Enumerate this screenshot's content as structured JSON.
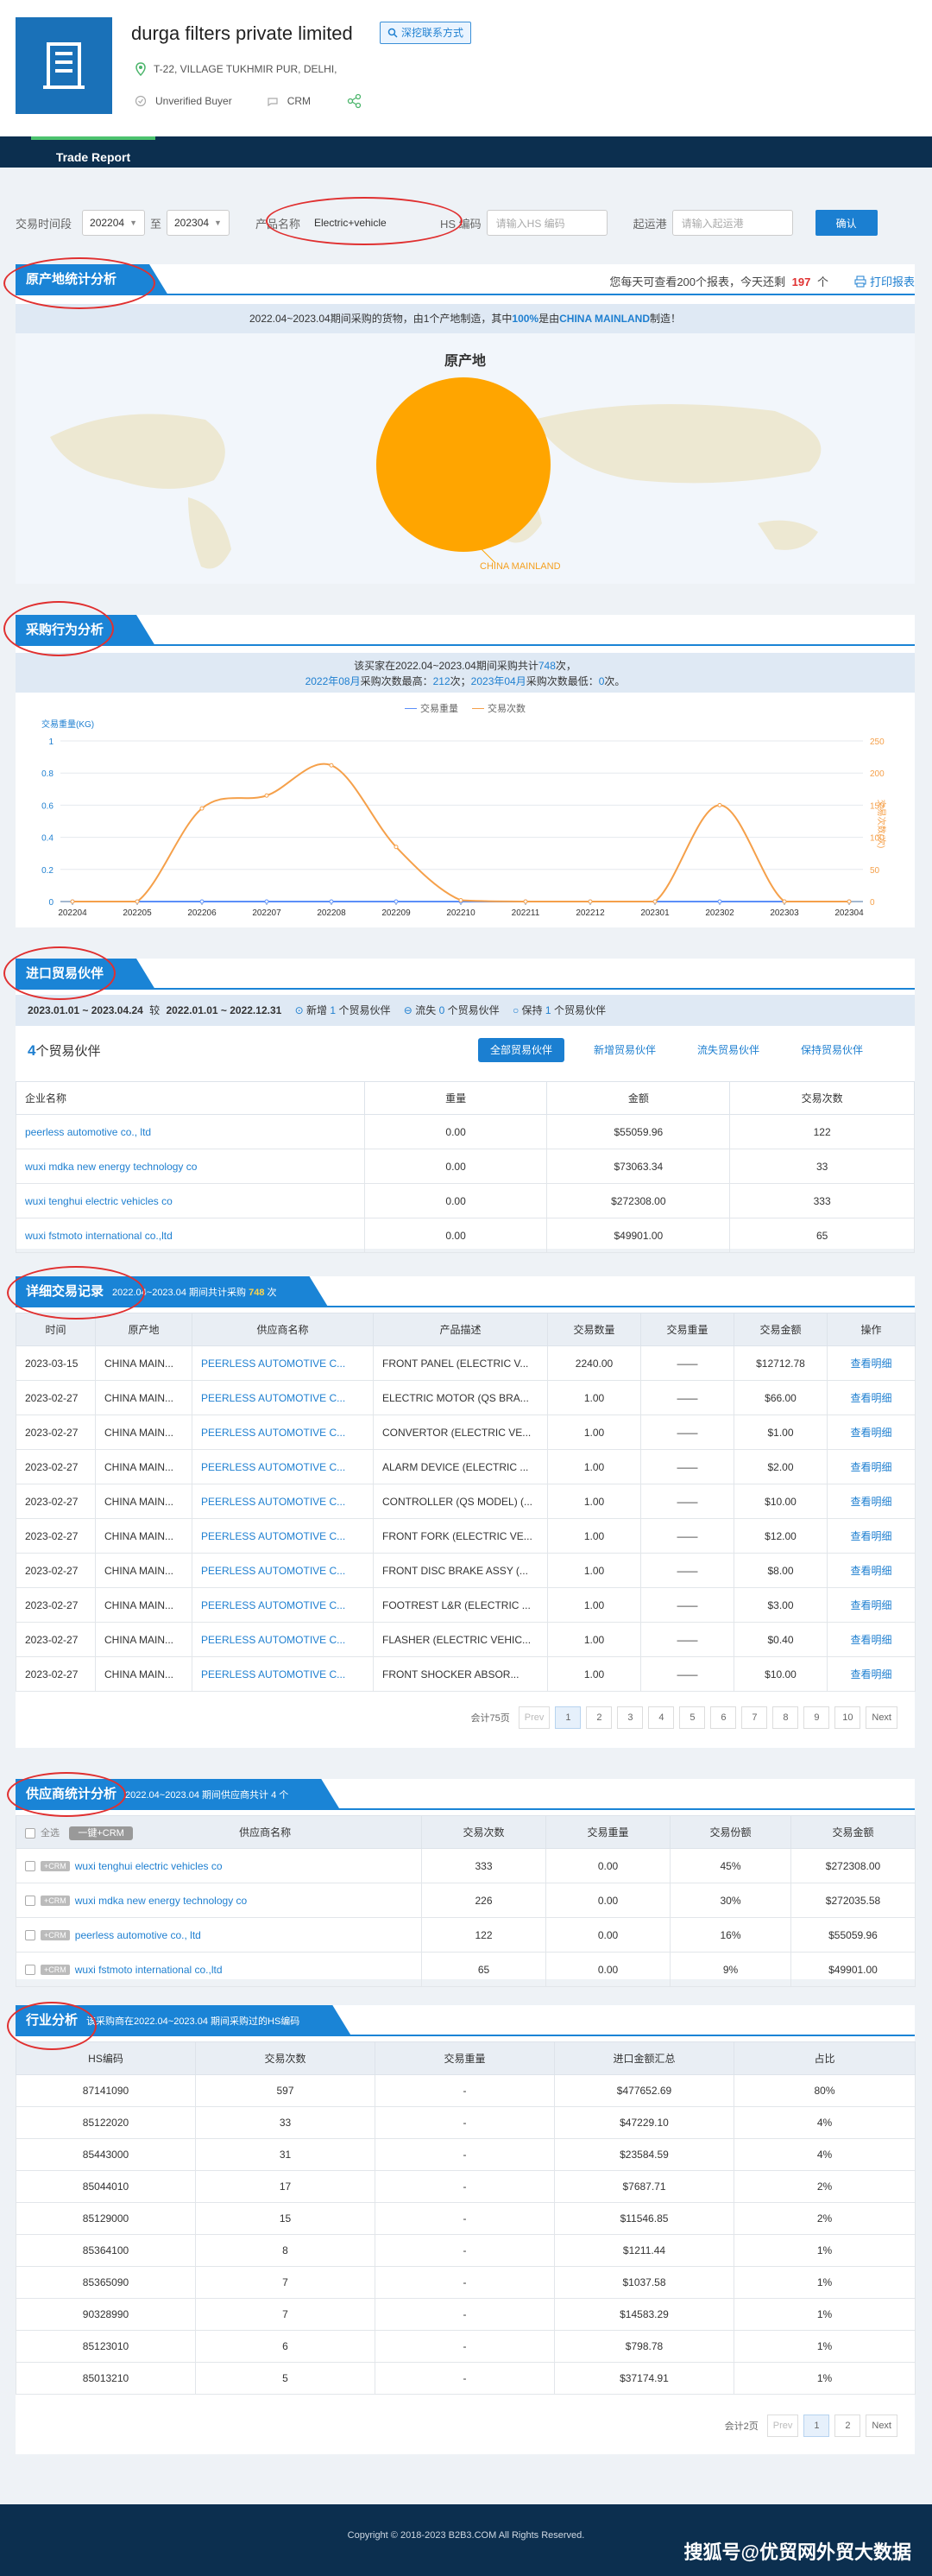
{
  "header": {
    "company": "durga filters private limited",
    "contact_btn": "深挖联系方式",
    "address": "T-22, VILLAGE TUKHMIR PUR, DELHI,",
    "buyer_status": "Unverified Buyer",
    "crm": "CRM",
    "tab": "Trade Report"
  },
  "filter": {
    "period_label": "交易时间段",
    "from": "202204",
    "to_label": "至",
    "to": "202304",
    "product_label": "产品名称",
    "product_value": "Electric+vehicle",
    "hs_label": "HS 编码",
    "hs_placeholder": "请输入HS 编码",
    "port_label": "起运港",
    "port_placeholder": "请输入起运港",
    "confirm": "确认"
  },
  "origin": {
    "title": "原产地统计分析",
    "quota_prefix": "您每天可查看200个报表，今天还剩",
    "quota_num": "197",
    "quota_suffix": "个",
    "print": "打印报表",
    "note_a": "2022.04~2023.04期间采购的货物，由1个产地制造，其中",
    "note_pct": "100%",
    "note_b": "是由",
    "note_country": "CHINA MAINLAND",
    "note_c": "制造！",
    "chart_title": "原产地",
    "slice_label": "CHINA MAINLAND"
  },
  "purchase": {
    "title": "采购行为分析",
    "note1_a": "该买家在2022.04~2023.04期间采购共计",
    "note1_num": "748",
    "note1_b": "次，",
    "note2_month1": "2022年08月",
    "note2_a": "采购次数最高：",
    "note2_num1": "212",
    "note2_b": "次；",
    "note2_month2": "2023年04月",
    "note2_c": "采购次数最低：",
    "note2_num2": "0",
    "note2_d": "次。",
    "legend_weight": "交易重量",
    "legend_count": "交易次数",
    "y_left_label": "交易重量(KG)",
    "y_right_label": "交易次数(次)"
  },
  "chart_data": {
    "type": "line",
    "x": [
      "202204",
      "202205",
      "202206",
      "202207",
      "202208",
      "202209",
      "202210",
      "202211",
      "202212",
      "202301",
      "202302",
      "202303",
      "202304"
    ],
    "series": [
      {
        "name": "交易重量",
        "axis": "left",
        "values": [
          0,
          0,
          0,
          0,
          0,
          0,
          0,
          0,
          0,
          0,
          0,
          0,
          0
        ],
        "color": "#5b8ff9"
      },
      {
        "name": "交易次数",
        "axis": "right",
        "values": [
          0,
          0,
          145,
          165,
          212,
          85,
          2,
          0,
          0,
          0,
          150,
          0,
          0
        ],
        "color": "#f5a04a"
      }
    ],
    "y_left": {
      "ticks": [
        "0",
        "0.2",
        "0.4",
        "0.6",
        "0.8",
        "1"
      ],
      "range": [
        0,
        1
      ]
    },
    "y_right": {
      "ticks": [
        "0",
        "50",
        "100",
        "150",
        "200",
        "250"
      ],
      "range": [
        0,
        250
      ]
    }
  },
  "partners": {
    "title": "进口贸易伙伴",
    "range_a": "2023.01.01 ~ 2023.04.24",
    "range_vs": "较",
    "range_b": "2022.01.01 ~ 2022.12.31",
    "new_a": "新增",
    "new_n": "1",
    "new_b": "个贸易伙伴",
    "lost_a": "流失",
    "lost_n": "0",
    "lost_b": "个贸易伙伴",
    "keep_a": "保持",
    "keep_n": "1",
    "keep_b": "个贸易伙伴",
    "count_num": "4",
    "count_text": "个贸易伙伴",
    "tabs": [
      "全部贸易伙伴",
      "新增贸易伙伴",
      "流失贸易伙伴",
      "保持贸易伙伴"
    ],
    "cols": [
      "企业名称",
      "重量",
      "金额",
      "交易次数"
    ],
    "rows": [
      [
        "peerless automotive co., ltd",
        "0.00",
        "$55059.96",
        "122"
      ],
      [
        "wuxi mdka new energy technology co",
        "0.00",
        "$73063.34",
        "33"
      ],
      [
        "wuxi tenghui electric vehicles co",
        "0.00",
        "$272308.00",
        "333"
      ],
      [
        "wuxi fstmoto international co.,ltd",
        "0.00",
        "$49901.00",
        "65"
      ]
    ]
  },
  "records": {
    "title": "详细交易记录",
    "sub_a": "2022.04~2023.04 期间共计采购",
    "sub_num": "748",
    "sub_b": "次",
    "cols": [
      "时间",
      "原产地",
      "供应商名称",
      "产品描述",
      "交易数量",
      "交易重量",
      "交易金额",
      "操作"
    ],
    "rows": [
      [
        "2023-03-15",
        "CHINA MAIN...",
        "PEERLESS AUTOMOTIVE C...",
        "FRONT PANEL (ELECTRIC V...",
        "2240.00",
        "——",
        "$12712.78",
        "查看明细"
      ],
      [
        "2023-02-27",
        "CHINA MAIN...",
        "PEERLESS AUTOMOTIVE C...",
        "ELECTRIC MOTOR (QS BRA...",
        "1.00",
        "——",
        "$66.00",
        "查看明细"
      ],
      [
        "2023-02-27",
        "CHINA MAIN...",
        "PEERLESS AUTOMOTIVE C...",
        "CONVERTOR (ELECTRIC VE...",
        "1.00",
        "——",
        "$1.00",
        "查看明细"
      ],
      [
        "2023-02-27",
        "CHINA MAIN...",
        "PEERLESS AUTOMOTIVE C...",
        "ALARM DEVICE (ELECTRIC ...",
        "1.00",
        "——",
        "$2.00",
        "查看明细"
      ],
      [
        "2023-02-27",
        "CHINA MAIN...",
        "PEERLESS AUTOMOTIVE C...",
        "CONTROLLER (QS MODEL) (...",
        "1.00",
        "——",
        "$10.00",
        "查看明细"
      ],
      [
        "2023-02-27",
        "CHINA MAIN...",
        "PEERLESS AUTOMOTIVE C...",
        "FRONT FORK (ELECTRIC VE...",
        "1.00",
        "——",
        "$12.00",
        "查看明细"
      ],
      [
        "2023-02-27",
        "CHINA MAIN...",
        "PEERLESS AUTOMOTIVE C...",
        "FRONT DISC BRAKE ASSY (...",
        "1.00",
        "——",
        "$8.00",
        "查看明细"
      ],
      [
        "2023-02-27",
        "CHINA MAIN...",
        "PEERLESS AUTOMOTIVE C...",
        "FOOTREST L&R (ELECTRIC ...",
        "1.00",
        "——",
        "$3.00",
        "查看明细"
      ],
      [
        "2023-02-27",
        "CHINA MAIN...",
        "PEERLESS AUTOMOTIVE C...",
        "FLASHER (ELECTRIC VEHIC...",
        "1.00",
        "——",
        "$0.40",
        "查看明细"
      ],
      [
        "2023-02-27",
        "CHINA MAIN...",
        "PEERLESS AUTOMOTIVE C...",
        "FRONT SHOCKER ABSOR...",
        "1.00",
        "——",
        "$10.00",
        "查看明细"
      ]
    ],
    "total": "会计75页",
    "pages": [
      "Prev",
      "1",
      "2",
      "3",
      "4",
      "5",
      "6",
      "7",
      "8",
      "9",
      "10",
      "Next"
    ]
  },
  "suppliers": {
    "title": "供应商统计分析",
    "sub": "2022.04~2023.04 期间供应商共计 4 个",
    "select_all": "全选",
    "crm_btn": "一键+CRM",
    "cols": [
      "供应商名称",
      "交易次数",
      "交易重量",
      "交易份额",
      "交易金额"
    ],
    "tag": "+CRM",
    "rows": [
      [
        "wuxi tenghui electric vehicles co",
        "333",
        "0.00",
        "45%",
        "$272308.00"
      ],
      [
        "wuxi mdka new energy technology co",
        "226",
        "0.00",
        "30%",
        "$272035.58"
      ],
      [
        "peerless automotive co., ltd",
        "122",
        "0.00",
        "16%",
        "$55059.96"
      ],
      [
        "wuxi fstmoto international co.,ltd",
        "65",
        "0.00",
        "9%",
        "$49901.00"
      ]
    ]
  },
  "industry": {
    "title": "行业分析",
    "sub": "该采购商在2022.04~2023.04 期间采购过的HS编码",
    "cols": [
      "HS编码",
      "交易次数",
      "交易重量",
      "进口金额汇总",
      "占比"
    ],
    "rows": [
      [
        "87141090",
        "597",
        "-",
        "$477652.69",
        "80%"
      ],
      [
        "85122020",
        "33",
        "-",
        "$47229.10",
        "4%"
      ],
      [
        "85443000",
        "31",
        "-",
        "$23584.59",
        "4%"
      ],
      [
        "85044010",
        "17",
        "-",
        "$7687.71",
        "2%"
      ],
      [
        "85129000",
        "15",
        "-",
        "$11546.85",
        "2%"
      ],
      [
        "85364100",
        "8",
        "-",
        "$1211.44",
        "1%"
      ],
      [
        "85365090",
        "7",
        "-",
        "$1037.58",
        "1%"
      ],
      [
        "90328990",
        "7",
        "-",
        "$14583.29",
        "1%"
      ],
      [
        "85123010",
        "6",
        "-",
        "$798.78",
        "1%"
      ],
      [
        "85013210",
        "5",
        "-",
        "$37174.91",
        "1%"
      ]
    ],
    "total": "会计2页",
    "pages": [
      "Prev",
      "1",
      "2",
      "Next"
    ]
  },
  "footer": {
    "copyright": "Copyright © 2018-2023 B2B3.COM All Rights Reserved.",
    "watermark": "搜狐号@优贸网外贸大数据"
  },
  "colors": {
    "accent": "#1a84d6",
    "navy": "#0c2f4f",
    "pie": "#ffa500",
    "line": "#f5a04a",
    "highlight": "#e03030"
  }
}
